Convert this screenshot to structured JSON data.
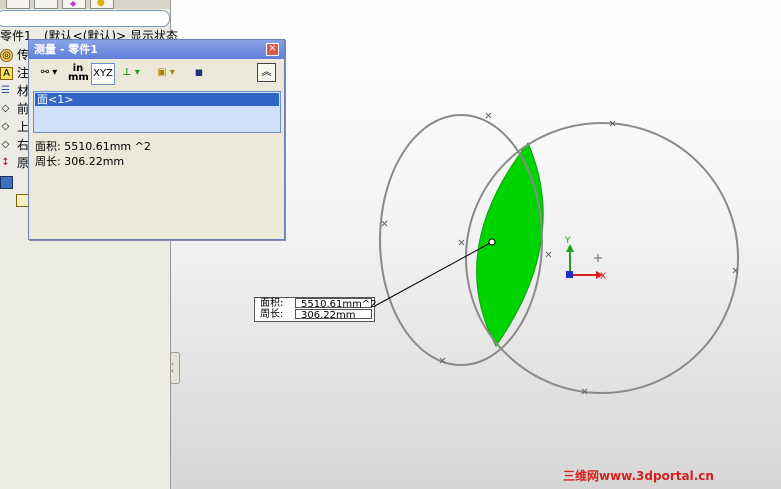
{
  "feature_tree": {
    "root_label": "零件1",
    "root_config": "(默认<(默认)> 显示状态",
    "items": [
      {
        "label": "传",
        "icon": "sensor-icon"
      },
      {
        "label": "注",
        "icon": "annotation-icon"
      },
      {
        "label": "材",
        "icon": "material-icon"
      },
      {
        "label": "前",
        "icon": "plane-icon"
      },
      {
        "label": "上",
        "icon": "plane-icon"
      },
      {
        "label": "右",
        "icon": "plane-icon"
      },
      {
        "label": "原",
        "icon": "origin-icon"
      }
    ]
  },
  "measure_dialog": {
    "title": "测量 - 零件1",
    "unit_label_top": "in",
    "unit_label_bottom": "mm",
    "xyz_label": "XYZ",
    "selection": [
      "面<1>"
    ],
    "results": {
      "area": "面积: 5510.61mm ^2",
      "perimeter": "周长: 306.22mm"
    }
  },
  "callout": {
    "area_label": "面积:",
    "area_value": "5510.61mm^2",
    "perimeter_label": "周长:",
    "perimeter_value": "306.22mm"
  },
  "triad": {
    "x": "X",
    "y": "Y"
  },
  "watermark": "三维网www.3dportal.cn",
  "colors": {
    "selected_face": "#00d400",
    "dialog_title": "#6d8be0",
    "selection_highlight": "#3166c6",
    "watermark": "#d62020"
  }
}
